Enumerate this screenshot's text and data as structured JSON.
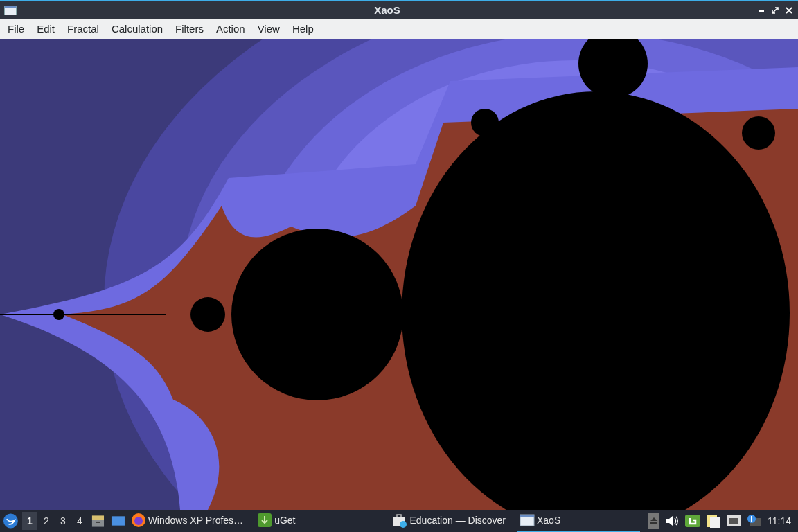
{
  "window": {
    "title": "XaoS"
  },
  "menu": [
    "File",
    "Edit",
    "Fractal",
    "Calculation",
    "Filters",
    "Action",
    "View",
    "Help"
  ],
  "taskbar": {
    "workspaces": [
      {
        "label": "1",
        "selected": true
      },
      {
        "label": "2",
        "selected": false
      },
      {
        "label": "3",
        "selected": false
      },
      {
        "label": "4",
        "selected": false
      }
    ],
    "tasks": [
      {
        "kind": "firefox",
        "label": "Windows XP Profes…",
        "selected": false
      },
      {
        "kind": "uget",
        "label": "uGet",
        "selected": false
      },
      {
        "kind": "discover",
        "label": "Education — Discover",
        "selected": false
      },
      {
        "kind": "window",
        "label": "XaoS",
        "selected": true
      }
    ],
    "clock": "11:14"
  }
}
